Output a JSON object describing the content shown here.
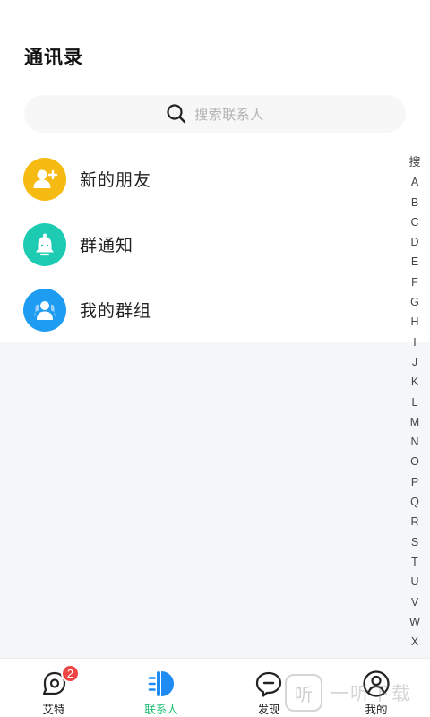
{
  "page_title": "通讯录",
  "search": {
    "placeholder": "搜索联系人",
    "icon": "search-icon"
  },
  "items": [
    {
      "label": "新的朋友",
      "icon": "add-friend-icon",
      "color": "#f5bb12"
    },
    {
      "label": "群通知",
      "icon": "bell-icon",
      "color": "#1ccbb2"
    },
    {
      "label": "我的群组",
      "icon": "group-icon",
      "color": "#1e9cf2"
    }
  ],
  "index_bar": [
    "搜",
    "A",
    "B",
    "C",
    "D",
    "E",
    "F",
    "G",
    "H",
    "I",
    "J",
    "K",
    "L",
    "M",
    "N",
    "O",
    "P",
    "Q",
    "R",
    "S",
    "T",
    "U",
    "V",
    "W",
    "X"
  ],
  "tabs": [
    {
      "label": "艾特",
      "icon": "aite-icon",
      "badge": "2",
      "active": false
    },
    {
      "label": "联系人",
      "icon": "contacts-icon",
      "active": true
    },
    {
      "label": "发现",
      "icon": "discover-icon",
      "active": false
    },
    {
      "label": "我的",
      "icon": "profile-icon",
      "active": false
    }
  ],
  "colors": {
    "active_tab": "#1fbf72",
    "badge": "#ee4444",
    "contacts_blue": "#1e8cf2"
  },
  "watermark": {
    "logo": "听",
    "text": "一听下载"
  }
}
